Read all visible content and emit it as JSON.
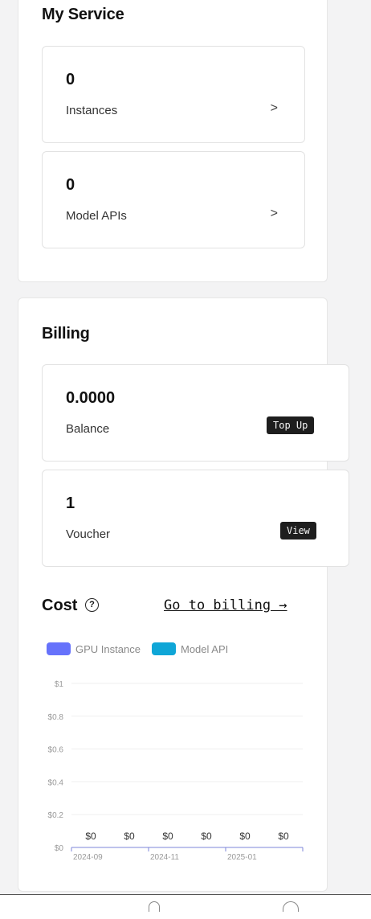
{
  "my_service": {
    "title": "My Service",
    "cards": [
      {
        "value": "0",
        "label": "Instances",
        "chevron": ">"
      },
      {
        "value": "0",
        "label": "Model APIs",
        "chevron": ">"
      }
    ]
  },
  "billing": {
    "title": "Billing",
    "balance": {
      "value": "0.0000",
      "label": "Balance",
      "button": "Top Up"
    },
    "voucher": {
      "value": "1",
      "label": "Voucher",
      "button": "View"
    }
  },
  "cost": {
    "title": "Cost",
    "help_icon": "?",
    "link": "Go to billing →"
  },
  "chart_data": {
    "type": "bar",
    "series": [
      {
        "name": "GPU Instance",
        "color": "#6672fb",
        "values": [
          0,
          0,
          0,
          0,
          0,
          0
        ]
      },
      {
        "name": "Model API",
        "color": "#0fa6d7",
        "values": [
          0,
          0,
          0,
          0,
          0,
          0
        ]
      }
    ],
    "categories": [
      "",
      "",
      "",
      "",
      "",
      ""
    ],
    "data_labels": [
      "$0",
      "$0",
      "$0",
      "$0",
      "$0",
      "$0"
    ],
    "x_tick_labels": [
      "2024-09",
      "2024-11",
      "2025-01"
    ],
    "y_tick_labels": [
      "$0",
      "$0.2",
      "$0.4",
      "$0.6",
      "$0.8",
      "$1"
    ],
    "ylim": [
      0,
      1
    ],
    "grid": true,
    "legend": "top-left"
  }
}
